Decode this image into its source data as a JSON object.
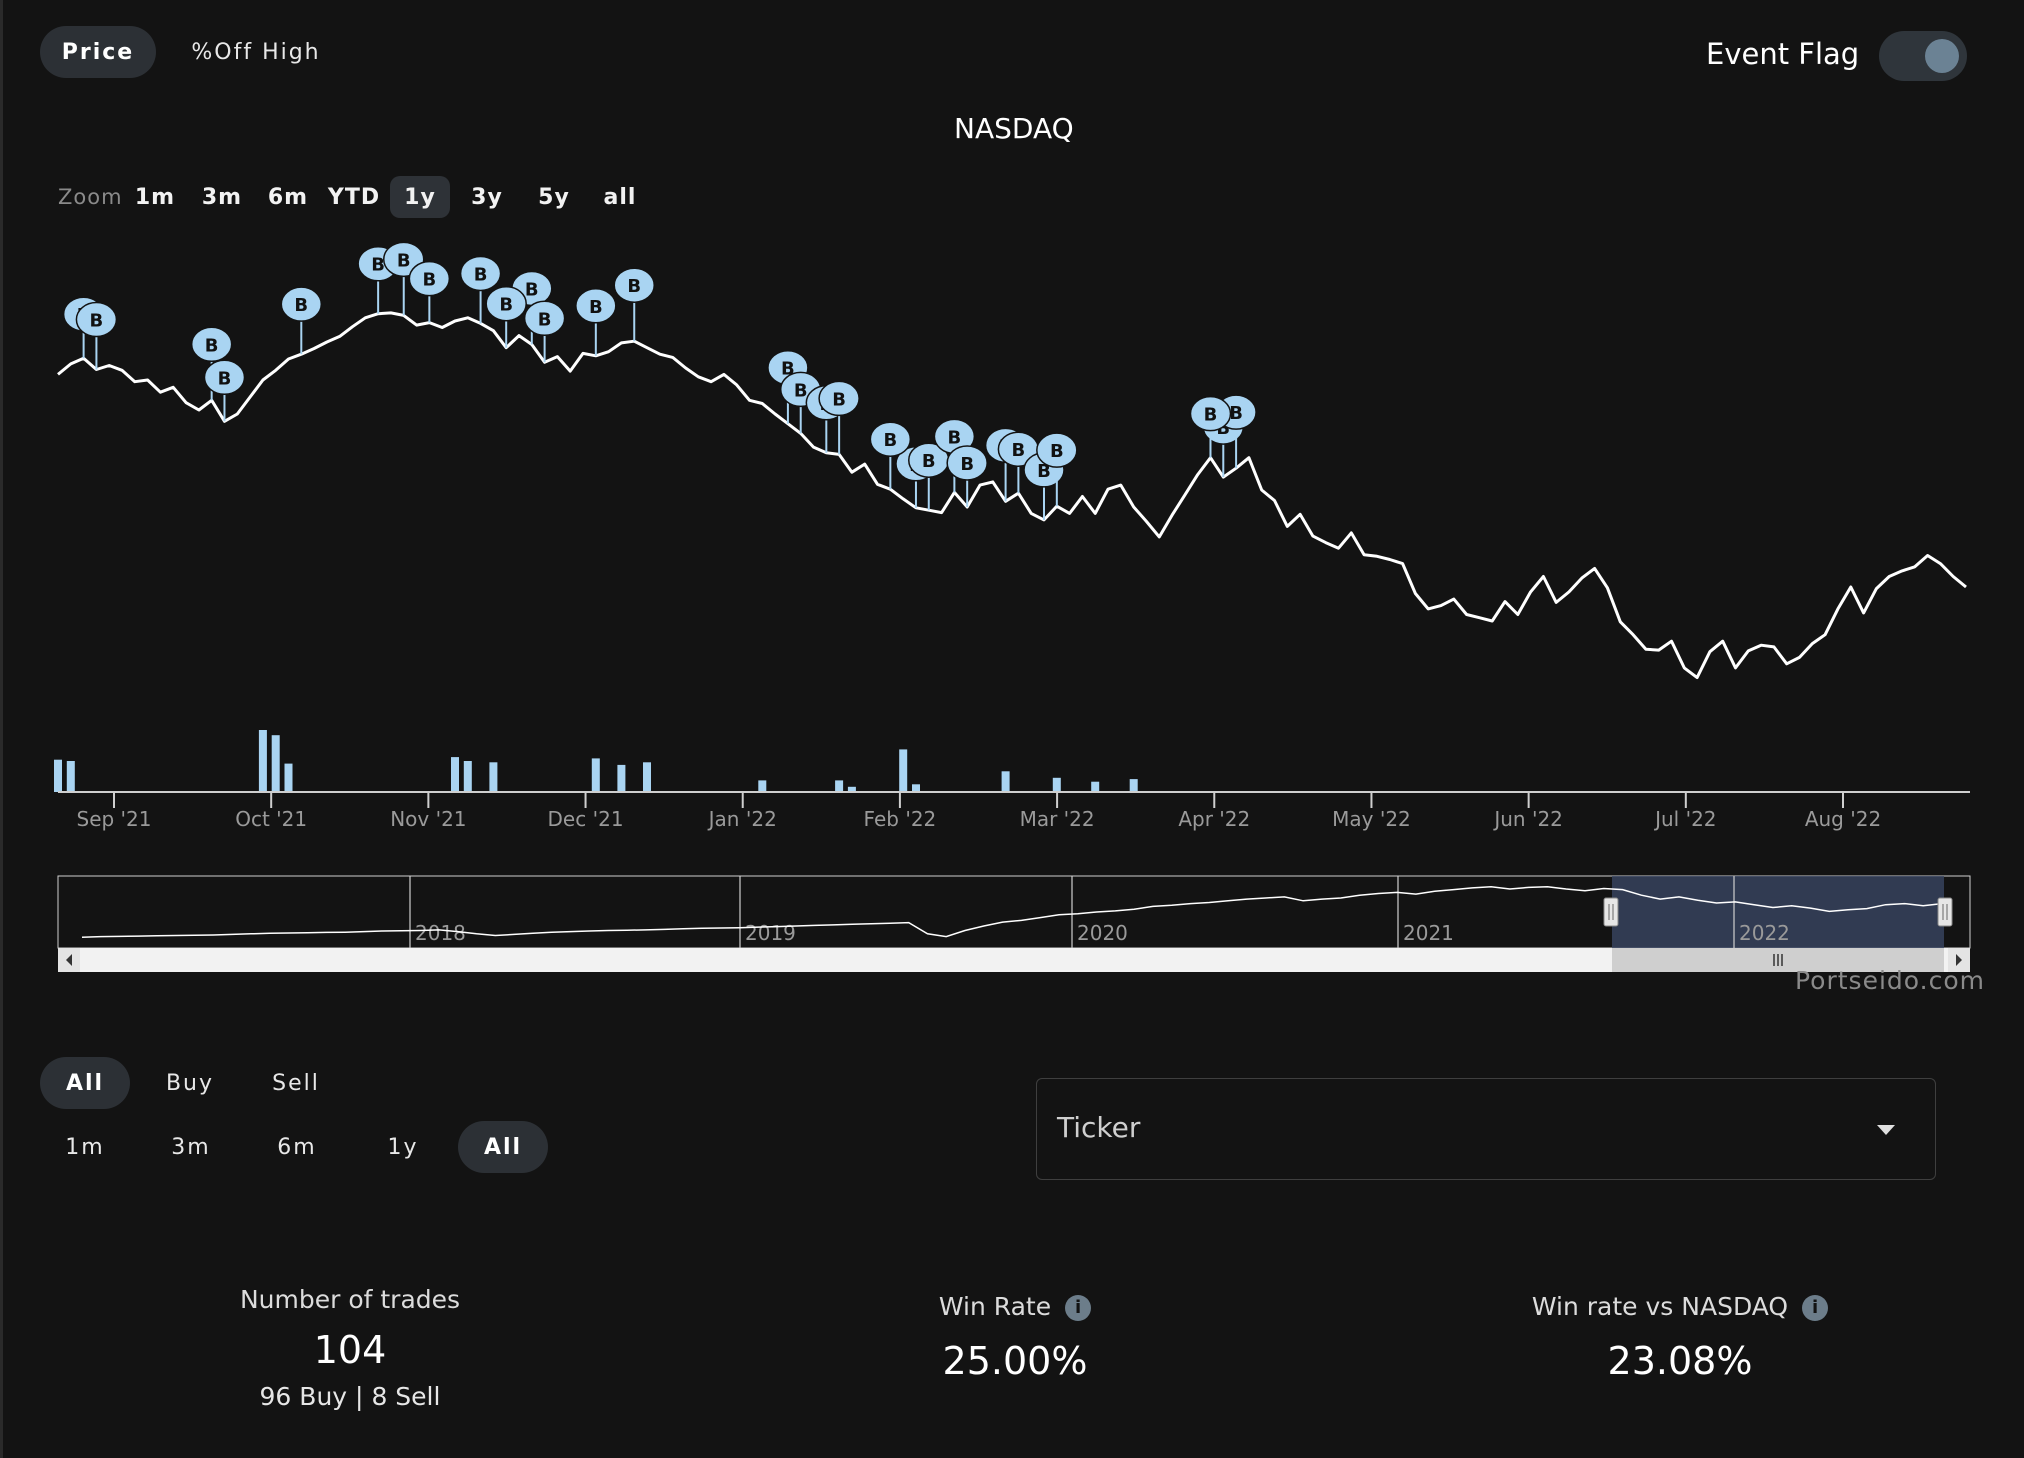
{
  "view_toggle": {
    "price": "Price",
    "off_high": "%Off High"
  },
  "event_flag": {
    "label": "Event Flag",
    "enabled": true,
    "accent": "#6b8294"
  },
  "chart_title": "NASDAQ",
  "zoom": {
    "label": "Zoom",
    "options": [
      "1m",
      "3m",
      "6m",
      "YTD",
      "1y",
      "3y",
      "5y",
      "all"
    ],
    "selected": "1y"
  },
  "flag_letter": "B",
  "chart_data": {
    "type": "line",
    "title": "NASDAQ",
    "x_tick_labels": [
      "Sep '21",
      "Oct '21",
      "Nov '21",
      "Dec '21",
      "Jan '22",
      "Feb '22",
      "Mar '22",
      "Apr '22",
      "May '22",
      "Jun '22",
      "Jul '22",
      "Aug '22"
    ],
    "series": [
      {
        "values": [
          15280,
          15410,
          15480,
          15340,
          15390,
          15330,
          15190,
          15210,
          15060,
          15120,
          14930,
          14840,
          14960,
          14700,
          14790,
          15000,
          15210,
          15330,
          15470,
          15530,
          15600,
          15680,
          15750,
          15870,
          15980,
          16030,
          16040,
          16010,
          15890,
          15920,
          15860,
          15940,
          15980,
          15910,
          15820,
          15610,
          15760,
          15650,
          15430,
          15500,
          15320,
          15540,
          15510,
          15560,
          15670,
          15690,
          15610,
          15530,
          15490,
          15360,
          15250,
          15190,
          15280,
          15150,
          14960,
          14920,
          14790,
          14670,
          14550,
          14380,
          14310,
          14290,
          14070,
          14170,
          13920,
          13860,
          13740,
          13630,
          13600,
          13570,
          13820,
          13640,
          13910,
          13950,
          13710,
          13810,
          13560,
          13480,
          13650,
          13560,
          13770,
          13560,
          13860,
          13910,
          13640,
          13460,
          13270,
          13540,
          13790,
          14040,
          14250,
          14010,
          14120,
          14250,
          13850,
          13720,
          13400,
          13550,
          13280,
          13200,
          13130,
          13320,
          13050,
          13030,
          12990,
          12940,
          12570,
          12380,
          12420,
          12500,
          12310,
          12270,
          12230,
          12470,
          12310,
          12590,
          12780,
          12460,
          12590,
          12760,
          12880,
          12640,
          12220,
          12060,
          11880,
          11870,
          11980,
          11650,
          11530,
          11850,
          11980,
          11650,
          11860,
          11930,
          11910,
          11700,
          11780,
          11950,
          12060,
          12380,
          12650,
          12330,
          12630,
          12780,
          12850,
          12900,
          13040,
          12940,
          12780,
          12650
        ]
      }
    ],
    "buy_flag_values": [
      15480,
      15340,
      14960,
      14700,
      16030,
      16010,
      15920,
      15910,
      15650,
      15430,
      15510,
      15690,
      15610,
      15530,
      14670,
      14550,
      14310,
      14290,
      13630,
      13600,
      13820,
      13640,
      13860,
      13710,
      13810,
      13480,
      13650,
      14250,
      14010,
      14120,
      14250
    ],
    "volume": [
      25,
      24,
      0,
      0,
      0,
      0,
      0,
      0,
      0,
      0,
      0,
      0,
      0,
      0,
      0,
      0,
      48,
      44,
      22,
      0,
      0,
      0,
      0,
      0,
      0,
      0,
      0,
      0,
      0,
      0,
      0,
      27,
      24,
      0,
      23,
      0,
      0,
      0,
      0,
      0,
      0,
      0,
      26,
      0,
      21,
      0,
      23,
      0,
      0,
      0,
      0,
      0,
      0,
      0,
      0,
      9,
      0,
      0,
      0,
      0,
      0,
      9,
      4,
      0,
      0,
      0,
      33,
      6,
      0,
      0,
      0,
      0,
      0,
      0,
      16,
      0,
      0,
      0,
      11,
      0,
      0,
      8,
      0,
      0,
      10,
      0,
      0,
      0,
      0,
      0,
      0,
      0,
      0,
      0,
      0,
      0,
      0,
      0,
      0,
      0,
      0,
      0,
      0,
      0,
      0,
      0,
      0,
      0,
      0,
      0,
      0,
      0,
      0,
      0,
      0,
      0,
      0,
      0,
      0,
      0,
      0,
      0,
      0,
      0,
      0,
      0,
      0,
      0,
      0,
      0,
      0,
      0,
      0,
      0,
      0,
      0,
      0,
      0,
      0,
      0,
      0,
      0,
      0,
      0,
      0,
      0,
      0,
      0,
      0,
      0,
      0
    ],
    "navigator": {
      "x_tick_labels": [
        "2018",
        "2019",
        "2020",
        "2021",
        "2022"
      ],
      "values": [
        7000,
        7100,
        7150,
        7200,
        7250,
        7300,
        7350,
        7400,
        7500,
        7600,
        7700,
        7750,
        7800,
        7850,
        7900,
        8000,
        8100,
        8150,
        8200,
        8300,
        8000,
        7600,
        7300,
        7500,
        7700,
        7900,
        8000,
        8100,
        8200,
        8250,
        8300,
        8400,
        8500,
        8600,
        8650,
        8700,
        8800,
        8900,
        9000,
        9100,
        9200,
        9300,
        9400,
        9500,
        9600,
        7600,
        7100,
        8200,
        9000,
        9700,
        10000,
        10500,
        11000,
        11200,
        11500,
        11700,
        12000,
        12500,
        12700,
        13000,
        13200,
        13500,
        13800,
        14000,
        14200,
        13500,
        13800,
        14000,
        14500,
        14800,
        15000,
        14700,
        15200,
        15500,
        15800,
        16000,
        15600,
        15900,
        16000,
        15600,
        15300,
        15700,
        15500,
        14500,
        13800,
        14200,
        13600,
        13100,
        13300,
        12800,
        12300,
        12600,
        12200,
        11600,
        11900,
        12100,
        12800,
        13000,
        12600,
        13000
      ],
      "selected_range": "1y"
    },
    "colors": {
      "line": "#ffffff",
      "flag": "#a9d4f2",
      "volume": "#a9d4f2"
    }
  },
  "brand": "Portseido.com",
  "trade_filter": {
    "type": [
      "All",
      "Buy",
      "Sell"
    ],
    "type_selected": "All",
    "period": [
      "1m",
      "3m",
      "6m",
      "1y",
      "All"
    ],
    "period_selected": "All"
  },
  "ticker_select": {
    "placeholder": "Ticker"
  },
  "stats": {
    "trades_label": "Number of trades",
    "trades_value": "104",
    "buy_count": "96",
    "buy_label": "Buy",
    "separator": "|",
    "sell_count": "8",
    "sell_label": "Sell",
    "win_rate_label": "Win Rate",
    "win_rate_value": "25.00%",
    "win_vs_label": "Win rate vs NASDAQ",
    "win_vs_value": "23.08%",
    "info_glyph": "i"
  }
}
